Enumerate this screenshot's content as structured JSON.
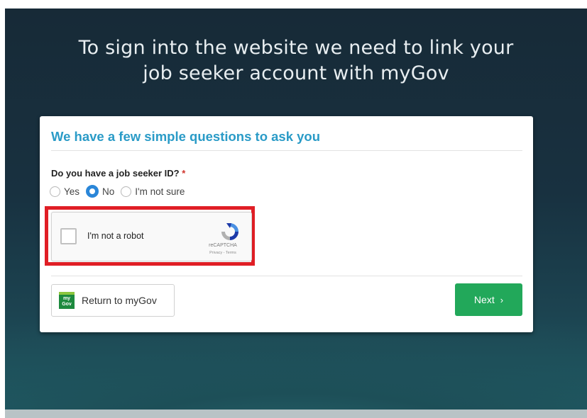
{
  "page": {
    "headline_line1": "To sign into the website we need to link your",
    "headline_line2": "job seeker account with myGov"
  },
  "card": {
    "title": "We have a few simple questions to ask you",
    "question": "Do you have a job seeker ID?",
    "required_marker": "*",
    "options": [
      {
        "label": "Yes",
        "selected": false
      },
      {
        "label": "No",
        "selected": true
      },
      {
        "label": "I'm not sure",
        "selected": false
      }
    ]
  },
  "recaptcha": {
    "label": "I'm not a robot",
    "brand": "reCAPTCHA",
    "links": "Privacy - Terms",
    "checked": false,
    "highlight_color": "#e01e25"
  },
  "actions": {
    "return_label": "Return to myGov",
    "return_logo_text_1": "my",
    "return_logo_text_2": "Gov",
    "next_label": "Next",
    "next_icon": "chevron-right-icon",
    "next_color": "#22a85a"
  },
  "colors": {
    "accent": "#2a9bc7",
    "radio_selected": "#2a86d8"
  }
}
